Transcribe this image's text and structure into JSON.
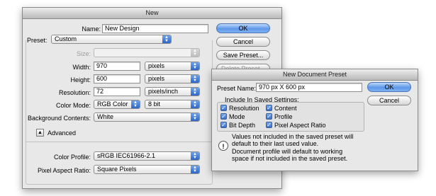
{
  "new_dialog": {
    "title": "New",
    "name_label": "Name:",
    "name_value": "New Design",
    "preset_label": "Preset:",
    "preset_value": "Custom",
    "size_label": "Size:",
    "size_value": "",
    "width_label": "Width:",
    "width_value": "970",
    "width_unit": "pixels",
    "height_label": "Height:",
    "height_value": "600",
    "height_unit": "pixels",
    "resolution_label": "Resolution:",
    "resolution_value": "72",
    "resolution_unit": "pixels/inch",
    "color_mode_label": "Color Mode:",
    "color_mode_value": "RGB Color",
    "bit_depth_value": "8 bit",
    "background_label": "Background Contents:",
    "background_value": "White",
    "advanced_label": "Advanced",
    "color_profile_label": "Color Profile:",
    "color_profile_value": "sRGB IEC61966-2.1",
    "pixel_aspect_label": "Pixel Aspect Ratio:",
    "pixel_aspect_value": "Square Pixels",
    "ok_label": "OK",
    "cancel_label": "Cancel",
    "save_preset_label": "Save Preset...",
    "delete_preset_label": "Delete Preset..."
  },
  "preset_dialog": {
    "title": "New Document Preset",
    "preset_name_label": "Preset Name:",
    "preset_name_value": "970 px X 600 px",
    "ok_label": "OK",
    "cancel_label": "Cancel",
    "include_label": "Include In Saved Settings:",
    "checkboxes": [
      {
        "label": "Resolution",
        "checked": true
      },
      {
        "label": "Content",
        "checked": true
      },
      {
        "label": "Mode",
        "checked": true
      },
      {
        "label": "Profile",
        "checked": true
      },
      {
        "label": "Bit Depth",
        "checked": true
      },
      {
        "label": "Pixel Aspect Ratio",
        "checked": true
      }
    ],
    "note_1": "Values not included in the saved preset will default to their last used value.",
    "note_2": "Document profile will default to working space if not included in the saved preset."
  },
  "colors": {
    "accent": "#4f8ae0",
    "window_bg": "#e8e8e8"
  },
  "icons": {
    "dropdown": "chevron-updown-icon",
    "warning": "exclamation-icon",
    "disclosure": "triangle-up-icon"
  }
}
